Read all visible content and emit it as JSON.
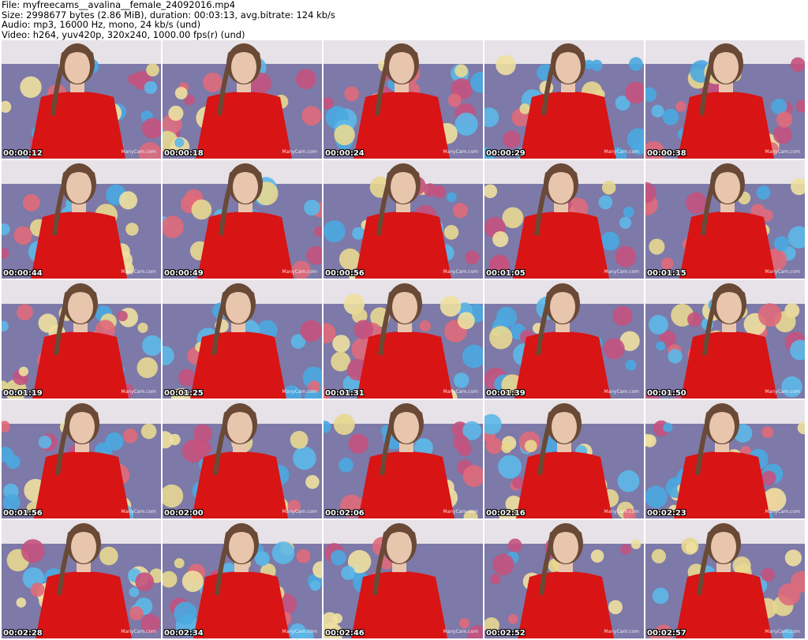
{
  "header": {
    "file": "File: myfreecams__avalina__female_24092016.mp4",
    "size": "Size: 2998677 bytes (2.86 MiB), duration: 00:03:13, avg.bitrate: 124 kb/s",
    "audio": "Audio: mp3, 16000 Hz, mono, 24 kb/s (und)",
    "video": "Video: h264, yuv420p, 320x240, 1000.00 fps(r) (und)"
  },
  "watermark": "ManyCam.com",
  "colors": {
    "shirt": "#d81414",
    "background_fabric": "#7d79a8",
    "wall": "#e6e2e8",
    "hair": "#6a4a36",
    "skin": "#e8c6ae"
  },
  "thumbnails": [
    "00:00:12",
    "00:00:18",
    "00:00:24",
    "00:00:29",
    "00:00:38",
    "00:00:44",
    "00:00:49",
    "00:00:56",
    "00:01:05",
    "00:01:15",
    "00:01:19",
    "00:01:25",
    "00:01:31",
    "00:01:39",
    "00:01:50",
    "00:01:56",
    "00:02:00",
    "00:02:06",
    "00:02:16",
    "00:02:23",
    "00:02:28",
    "00:02:34",
    "00:02:46",
    "00:02:52",
    "00:02:57"
  ]
}
